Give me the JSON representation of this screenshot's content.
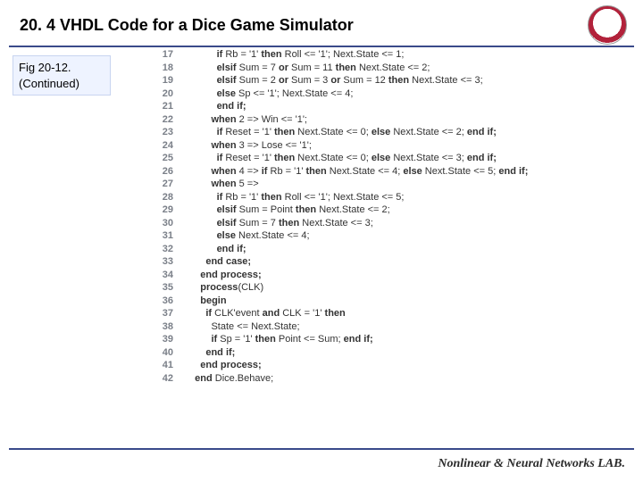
{
  "header": {
    "title": "20. 4 VHDL Code for a Dice Game Simulator"
  },
  "figlabel": {
    "line1": "Fig 20-12.",
    "line2": "(Continued)"
  },
  "code": {
    "lines": [
      {
        "n": "17",
        "indent": 5,
        "t": "<b>if</b> Rb = '1' <b>then</b> Roll <= '1'; Next.State <= 1;"
      },
      {
        "n": "18",
        "indent": 5,
        "t": "<b>elsif</b> Sum = 7 <b>or</b> Sum = 11 <b>then</b> Next.State <= 2;"
      },
      {
        "n": "19",
        "indent": 5,
        "t": "<b>elsif</b> Sum = 2 <b>or</b> Sum = 3 <b>or</b> Sum = 12 <b>then</b> Next.State <= 3;"
      },
      {
        "n": "20",
        "indent": 5,
        "t": "<b>else</b> Sp <= '1'; Next.State <= 4;"
      },
      {
        "n": "21",
        "indent": 5,
        "t": "<b>end if;</b>"
      },
      {
        "n": "22",
        "indent": 4,
        "t": "<b>when</b> 2 => Win <= '1';"
      },
      {
        "n": "23",
        "indent": 5,
        "t": "<b>if</b> Reset = '1' <b>then</b> Next.State <= 0; <b>else</b> Next.State <= 2; <b>end if;</b>"
      },
      {
        "n": "24",
        "indent": 4,
        "t": "<b>when</b> 3 => Lose <= '1';"
      },
      {
        "n": "25",
        "indent": 5,
        "t": "<b>if</b> Reset = '1' <b>then</b> Next.State <= 0; <b>else</b> Next.State <= 3; <b>end if;</b>"
      },
      {
        "n": "26",
        "indent": 4,
        "t": "<b>when</b> 4 => <b>if</b> Rb = '1' <b>then</b> Next.State <= 4; <b>else</b> Next.State <= 5; <b>end if;</b>"
      },
      {
        "n": "27",
        "indent": 4,
        "t": "<b>when</b> 5 =>"
      },
      {
        "n": "28",
        "indent": 5,
        "t": "<b>if</b> Rb = '1' <b>then</b> Roll <= '1'; Next.State <= 5;"
      },
      {
        "n": "29",
        "indent": 5,
        "t": "<b>elsif</b> Sum = Point <b>then</b> Next.State <= 2;"
      },
      {
        "n": "30",
        "indent": 5,
        "t": "<b>elsif</b> Sum = 7 <b>then</b> Next.State <= 3;"
      },
      {
        "n": "31",
        "indent": 5,
        "t": "<b>else</b> Next.State <= 4;"
      },
      {
        "n": "32",
        "indent": 5,
        "t": "<b>end if;</b>"
      },
      {
        "n": "33",
        "indent": 3,
        "t": "<b>end case;</b>"
      },
      {
        "n": "34",
        "indent": 2,
        "t": "<b>end process;</b>"
      },
      {
        "n": "35",
        "indent": 2,
        "t": "<b>process</b>(CLK)"
      },
      {
        "n": "36",
        "indent": 2,
        "t": "<b>begin</b>"
      },
      {
        "n": "37",
        "indent": 3,
        "t": "<b>if</b> CLK'event <b>and</b> CLK = '1' <b>then</b>"
      },
      {
        "n": "38",
        "indent": 4,
        "t": "State <= Next.State;"
      },
      {
        "n": "39",
        "indent": 4,
        "t": "<b>if</b> Sp = '1' <b>then</b> Point <= Sum; <b>end if;</b>"
      },
      {
        "n": "40",
        "indent": 3,
        "t": "<b>end if;</b>"
      },
      {
        "n": "41",
        "indent": 2,
        "t": "<b>end process;</b>"
      },
      {
        "n": "42",
        "indent": 1,
        "t": "<b>end</b> Dice.Behave;"
      }
    ]
  },
  "footer": {
    "text": "Nonlinear & Neural Networks LAB."
  }
}
